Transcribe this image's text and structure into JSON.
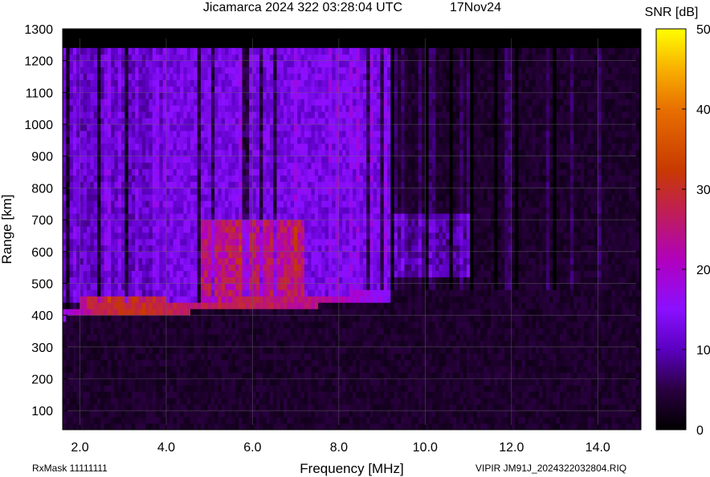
{
  "chart_data": {
    "type": "heatmap",
    "title": "Jicamarca 2024 322 03:28:04 UTC",
    "date_label": "17Nov24",
    "xlabel": "Frequency [MHz]",
    "ylabel": "Range [km]",
    "xlim": [
      1.6,
      15.0
    ],
    "ylim": [
      40,
      1300
    ],
    "x_ticks": [
      2.0,
      4.0,
      6.0,
      8.0,
      10.0,
      12.0,
      14.0
    ],
    "x_tick_labels": [
      "2.0",
      "4.0",
      "6.0",
      "8.0",
      "10.0",
      "12.0",
      "14.0"
    ],
    "y_ticks": [
      100,
      200,
      300,
      400,
      500,
      600,
      700,
      800,
      900,
      1000,
      1100,
      1200,
      1300
    ],
    "y_tick_labels": [
      "100",
      "200",
      "300",
      "400",
      "500",
      "600",
      "700",
      "800",
      "900",
      "1000",
      "1100",
      "1200",
      "1300"
    ],
    "colorbar": {
      "label": "SNR [dB]",
      "range": [
        0,
        50
      ],
      "ticks": [
        0,
        10,
        20,
        30,
        40,
        50
      ],
      "tick_labels": [
        "0",
        "10",
        "20",
        "30",
        "40",
        "50"
      ]
    },
    "grid": true,
    "data_extent": {
      "x": [
        1.6,
        15.0
      ],
      "y": [
        40,
        1240
      ]
    },
    "echo_trace": {
      "x_mhz": [
        1.6,
        2.5,
        3.5,
        4.5,
        5.5,
        6.5,
        7.5,
        8.5,
        9.2
      ],
      "virtual_height_km": [
        385,
        392,
        400,
        405,
        410,
        418,
        425,
        432,
        440
      ],
      "peak_snr_db": [
        18,
        27,
        28,
        25,
        26,
        25,
        23,
        18,
        15
      ]
    },
    "strong_regions": [
      {
        "x_range_mhz": [
          2.0,
          4.0
        ],
        "range_km": [
          400,
          440
        ],
        "snr_db": 28
      },
      {
        "x_range_mhz": [
          4.8,
          7.2
        ],
        "range_km": [
          440,
          680
        ],
        "snr_db": 26
      }
    ],
    "diffuse_regions": [
      {
        "x_range_mhz": [
          1.6,
          4.0
        ],
        "range_km": [
          440,
          1240
        ],
        "snr_db": 11
      },
      {
        "x_range_mhz": [
          4.0,
          9.2
        ],
        "range_km": [
          430,
          1240
        ],
        "snr_db": 13
      },
      {
        "x_range_mhz": [
          9.2,
          11.0
        ],
        "range_km": [
          510,
          700
        ],
        "snr_db": 9
      }
    ],
    "background_snr_db": 2
  },
  "footer": {
    "rxmask": "RxMask 11111111",
    "filename": "VIPIR  JM91J_2024322032804.RIQ"
  }
}
